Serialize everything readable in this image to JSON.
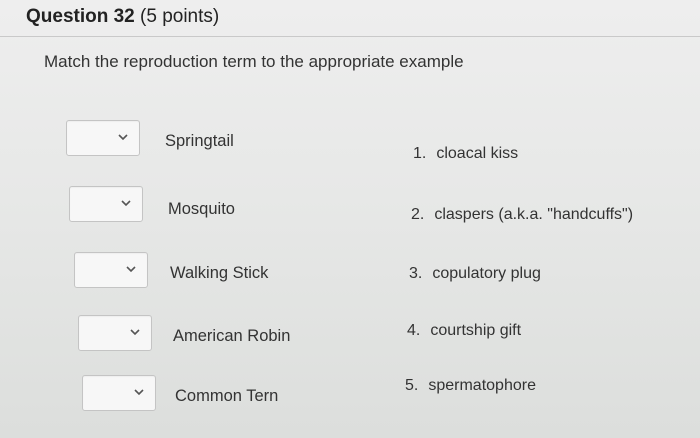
{
  "question": {
    "title": "Question 32",
    "points": "(5 points)",
    "prompt": "Match the reproduction term to the appropriate example"
  },
  "terms": [
    {
      "label": "Springtail",
      "selected": ""
    },
    {
      "label": "Mosquito",
      "selected": ""
    },
    {
      "label": "Walking Stick",
      "selected": ""
    },
    {
      "label": "American Robin",
      "selected": ""
    },
    {
      "label": "Common Tern",
      "selected": ""
    }
  ],
  "examples": [
    {
      "num": "1.",
      "text": "cloacal kiss"
    },
    {
      "num": "2.",
      "text": "claspers (a.k.a. \"handcuffs\")"
    },
    {
      "num": "3.",
      "text": "copulatory plug"
    },
    {
      "num": "4.",
      "text": "courtship gift"
    },
    {
      "num": "5.",
      "text": "spermatophore"
    }
  ],
  "icons": {
    "dropdown": "chevron-down-icon"
  }
}
